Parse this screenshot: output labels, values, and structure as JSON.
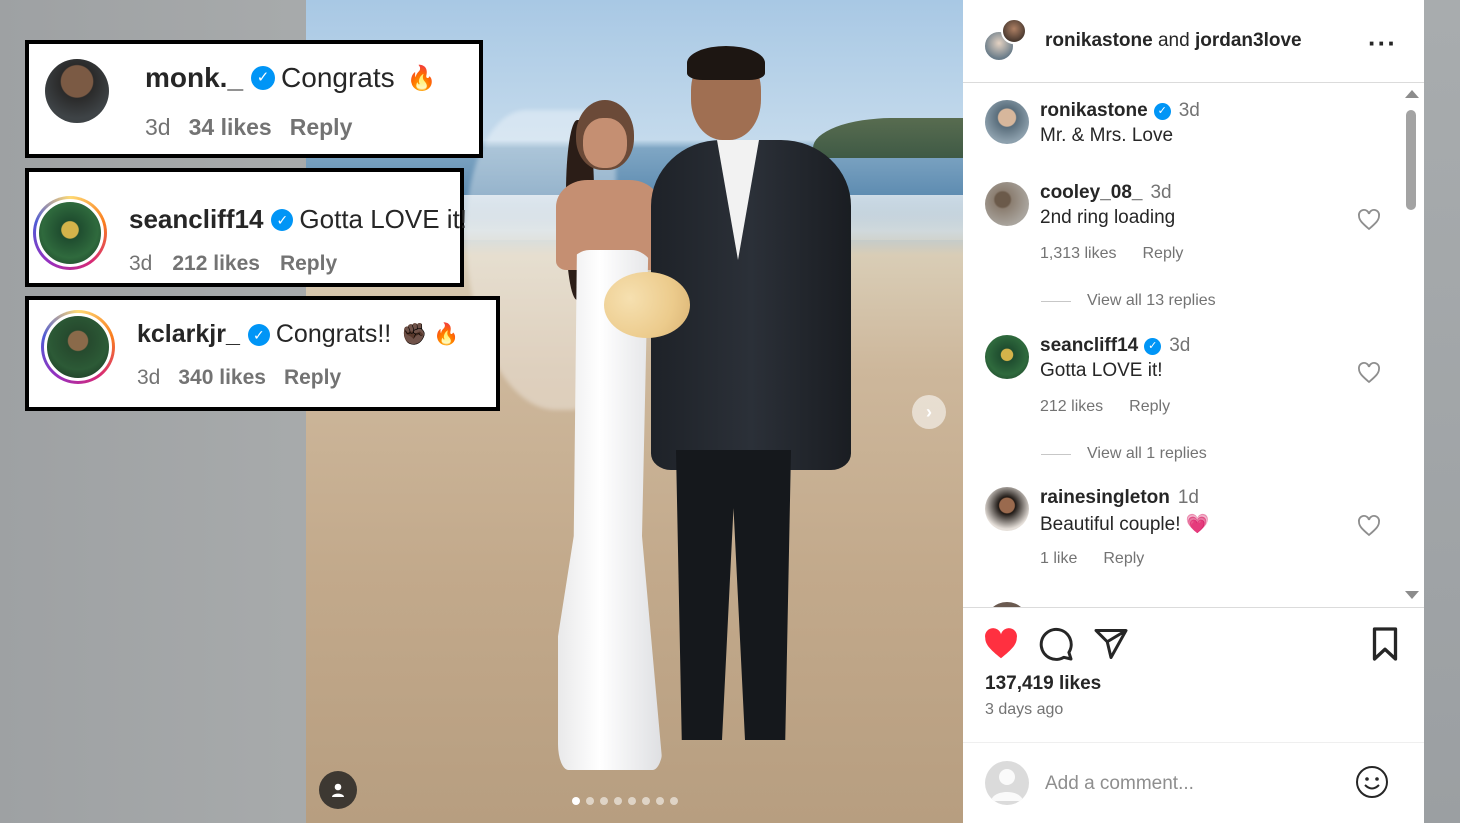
{
  "callouts": [
    {
      "username": "monk._",
      "text": "Congrats",
      "emoji": "🔥",
      "time": "3d",
      "likes": "34 likes",
      "reply": "Reply"
    },
    {
      "username": "seancliff14",
      "text": "Gotta LOVE it!",
      "emoji": "",
      "time": "3d",
      "likes": "212 likes",
      "reply": "Reply"
    },
    {
      "username": "kclarkjr_",
      "text": "Congrats!!",
      "emoji": "✊🏿 🔥",
      "time": "3d",
      "likes": "340 likes",
      "reply": "Reply"
    }
  ],
  "post": {
    "header": {
      "user1": "ronikastone",
      "conjunction": "and",
      "user2": "jordan3love"
    },
    "comments": [
      {
        "username": "ronikastone",
        "verified": true,
        "time": "3d",
        "text": "Mr. & Mrs. Love"
      },
      {
        "username": "cooley_08_",
        "verified": false,
        "time": "3d",
        "text": "2nd ring loading",
        "likes": "1,313 likes",
        "reply": "Reply",
        "view_replies": "View all 13 replies"
      },
      {
        "username": "seancliff14",
        "verified": true,
        "time": "3d",
        "text": "Gotta LOVE it!",
        "likes": "212 likes",
        "reply": "Reply",
        "view_replies": "View all 1 replies"
      },
      {
        "username": "rainesingleton",
        "verified": false,
        "time": "1d",
        "text": "Beautiful couple! 💗",
        "likes": "1 like",
        "reply": "Reply"
      }
    ],
    "likes_count": "137,419 likes",
    "posted": "3 days ago",
    "comment_placeholder": "Add a comment...",
    "liked": true
  },
  "carousel": {
    "total_slides": 8,
    "current": 1
  },
  "icons": {
    "verified": "verified-badge-icon",
    "like": "heart-icon",
    "comment": "comment-icon",
    "share": "paper-plane-icon",
    "save": "bookmark-icon",
    "more": "more-horizontal-icon",
    "next": "chevron-right-icon",
    "tag": "user-tag-icon",
    "emoji": "smiley-icon"
  },
  "colors": {
    "verified": "#0095f6",
    "liked_heart": "#ff3040",
    "text_primary": "#262626",
    "text_secondary": "#737373"
  }
}
